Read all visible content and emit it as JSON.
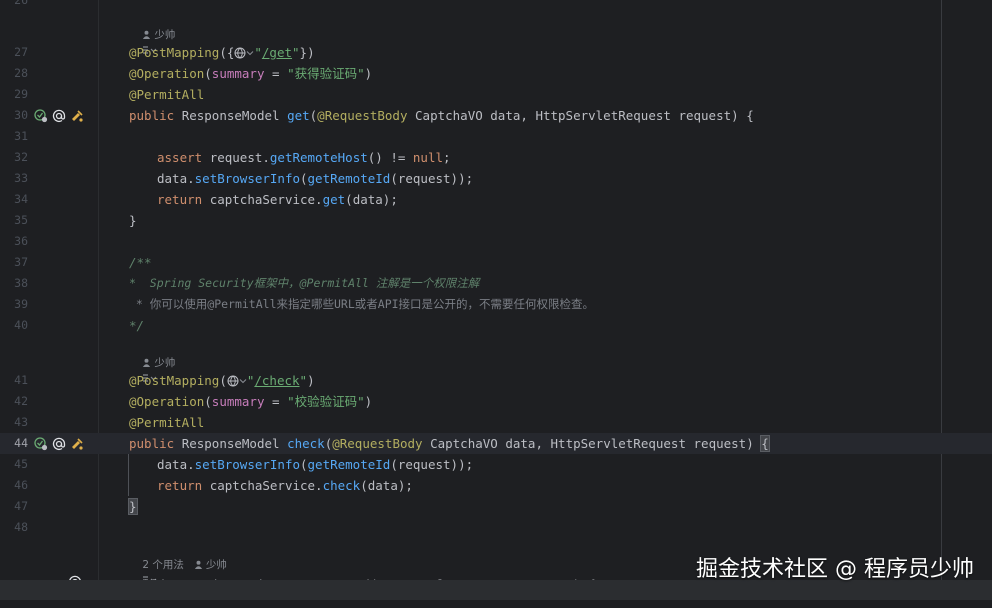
{
  "editor": {
    "line_numbers": [
      "26",
      "27",
      "28",
      "29",
      "30",
      "31",
      "32",
      "33",
      "34",
      "35",
      "36",
      "37",
      "38",
      "39",
      "40",
      "41",
      "42",
      "43",
      "44",
      "45",
      "46",
      "47",
      "48"
    ],
    "author_hint": "少帅",
    "usages_hint": "2 个用法",
    "method1": {
      "mapping_annotation": "@PostMapping",
      "mapping_open": "({",
      "mapping_path": "/get",
      "mapping_close": "})",
      "operation_annotation": "@Operation",
      "summary_attr": "summary",
      "summary_value": "\"获得验证码\"",
      "permit_annotation": "@PermitAll",
      "name": "get"
    },
    "method2": {
      "mapping_annotation": "@PostMapping",
      "mapping_open": "(",
      "mapping_path": "/check",
      "mapping_close": ")",
      "operation_annotation": "@Operation",
      "summary_attr": "summary",
      "summary_value": "\"校验验证码\"",
      "permit_annotation": "@PermitAll",
      "name": "check"
    },
    "signature": {
      "kw_public": "public",
      "return_type": "ResponseModel",
      "open": "(",
      "request_body": "@RequestBody",
      "vo_type": "CaptchaVO",
      "data_param": "data",
      "comma": ",",
      "req_type": "HttpServletRequest",
      "req_param": "request",
      "close": ")",
      "brace_open": "{",
      "brace_close": "}"
    },
    "body": {
      "assert_kw": "assert",
      "request": "request",
      "get_remote_host": "getRemoteHost",
      "neq_null": "() != ",
      "null_kw": "null",
      "semi": ";",
      "data": "data",
      "set_browser_info": "setBrowserInfo",
      "get_remote_id": "getRemoteId",
      "return_kw": "return",
      "captcha_service": "captchaService"
    },
    "javadoc": {
      "open": "/**",
      "line1": "*  Spring Security框架中，@PermitAll 注解是一个权限注解",
      "line2": " * 你可以使用@PermitAll来指定哪些URL或者API接口是公开的，不需要任何权限检查。",
      "close": "*/"
    },
    "next_line_partial": "public static String getRemoteId(HttpServletRequest request) {"
  },
  "watermark": "掘金技术社区 @ 程序员少帅"
}
